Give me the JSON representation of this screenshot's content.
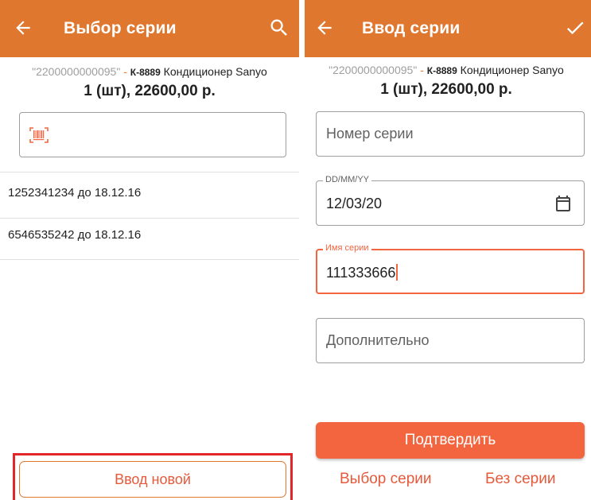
{
  "left_screen": {
    "appbar": {
      "title": "Выбор серии",
      "back_icon": "arrow-back-icon",
      "action_icon": "search-icon",
      "color": "#e0772e"
    },
    "product": {
      "barcode": "\"2200000000095\"",
      "separator": " - ",
      "article": "К-8889",
      "name": " Кондиционер Sanyo",
      "quantity_price": "1 (шт), 22600,00 р."
    },
    "scan_input": {
      "icon": "barcode-scanner-icon",
      "value": ""
    },
    "series_list": [
      {
        "label": "1252341234 до 18.12.16"
      },
      {
        "label": "6546535242 до 18.12.16"
      }
    ],
    "new_button": {
      "label": "Ввод новой"
    }
  },
  "right_screen": {
    "appbar": {
      "title": "Ввод серии",
      "back_icon": "arrow-back-icon",
      "action_icon": "check-icon",
      "color": "#e0772e"
    },
    "product": {
      "barcode": "\"2200000000095\"",
      "separator": " - ",
      "article": "К-8889",
      "name": " Кондиционер Sanyo",
      "quantity_price": "1 (шт), 22600,00 р."
    },
    "fields": {
      "series_number": {
        "placeholder": "Номер серии",
        "value": ""
      },
      "date": {
        "label": "DD/MM/YY",
        "value": "12/03/20",
        "icon": "calendar-icon"
      },
      "series_name": {
        "label": "Имя серии",
        "value": "111333666"
      },
      "additional": {
        "placeholder": "Дополнительно",
        "value": ""
      }
    },
    "confirm_button": {
      "label": "Подтвердить"
    },
    "links": {
      "select_series": "Выбор серии",
      "no_series": "Без серии"
    }
  },
  "colors": {
    "accent": "#e0772e",
    "primary_button": "#f2653f",
    "highlight_frame": "#e2262a"
  }
}
